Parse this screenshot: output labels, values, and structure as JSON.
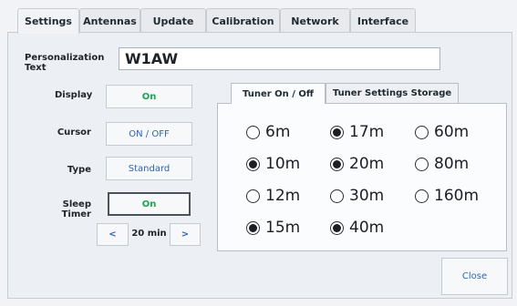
{
  "tabs": [
    "Settings",
    "Antennas",
    "Update",
    "Calibration",
    "Network",
    "Interface"
  ],
  "personalization": {
    "label": "Personalization Text",
    "value": "W1AW"
  },
  "display": {
    "label": "Display",
    "value": "On"
  },
  "cursor": {
    "label": "Cursor",
    "value": "ON / OFF"
  },
  "type": {
    "label": "Type",
    "value": "Standard"
  },
  "sleep_timer": {
    "label": "Sleep Timer",
    "value": "On",
    "prev": "<",
    "minutes": "20 min",
    "next": ">"
  },
  "subtabs": [
    "Tuner On / Off",
    "Tuner Settings Storage"
  ],
  "bands": [
    {
      "label": "6m",
      "checked": false
    },
    {
      "label": "17m",
      "checked": true
    },
    {
      "label": "60m",
      "checked": false
    },
    {
      "label": "10m",
      "checked": true
    },
    {
      "label": "20m",
      "checked": true
    },
    {
      "label": "80m",
      "checked": false
    },
    {
      "label": "12m",
      "checked": false
    },
    {
      "label": "30m",
      "checked": false
    },
    {
      "label": "160m",
      "checked": false
    },
    {
      "label": "15m",
      "checked": true
    },
    {
      "label": "40m",
      "checked": true
    }
  ],
  "close_label": "Close",
  "colors": {
    "on_green": "#1ea34f",
    "link_blue": "#2e64b6"
  }
}
